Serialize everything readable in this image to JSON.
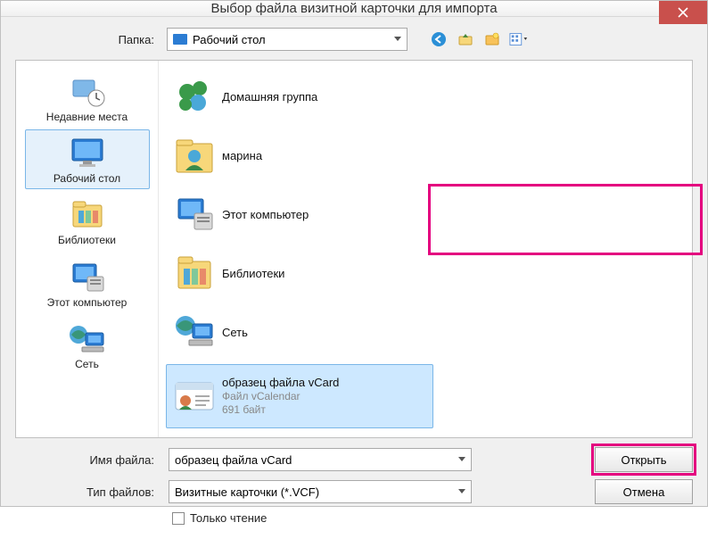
{
  "window": {
    "title": "Выбор файла визитной карточки для импорта"
  },
  "folder_row": {
    "label": "Папка:",
    "current": "Рабочий стол"
  },
  "places": [
    {
      "label": "Недавние места"
    },
    {
      "label": "Рабочий стол"
    },
    {
      "label": "Библиотеки"
    },
    {
      "label": "Этот компьютер"
    },
    {
      "label": "Сеть"
    }
  ],
  "files": {
    "items": [
      {
        "name": "Домашняя группа"
      },
      {
        "name": "марина"
      },
      {
        "name": "Этот компьютер"
      },
      {
        "name": "Библиотеки"
      },
      {
        "name": "Сеть"
      },
      {
        "name": "образец файла vCard",
        "meta1": "Файл vCalendar",
        "meta2": "691 байт"
      }
    ]
  },
  "bottom": {
    "filename_label": "Имя файла:",
    "filename_value": "образец файла vCard",
    "filetype_label": "Тип файлов:",
    "filetype_value": "Визитные карточки (*.VCF)",
    "readonly_label": "Только чтение",
    "open_btn": "Открыть",
    "cancel_btn": "Отмена"
  }
}
